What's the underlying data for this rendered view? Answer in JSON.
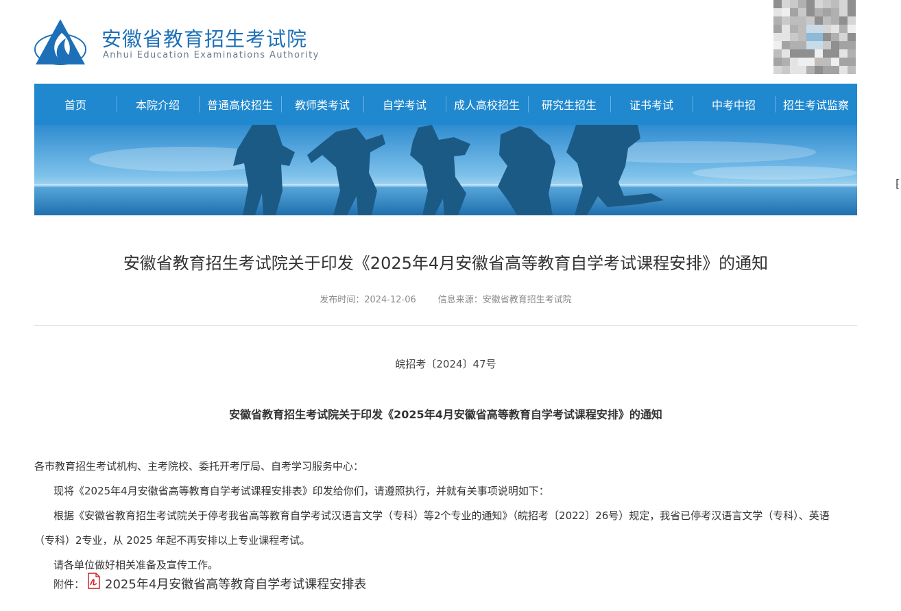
{
  "header": {
    "org_name": "安徽省教育招生考试院",
    "org_name_en": "Anhui Education Examinations Authority",
    "logo_icon": "triangle-flame-logo",
    "qr_icon": "qr-code-icon"
  },
  "nav": {
    "items": [
      {
        "label": "首页"
      },
      {
        "label": "本院介绍"
      },
      {
        "label": "普通高校招生"
      },
      {
        "label": "教师类考试"
      },
      {
        "label": "自学考试"
      },
      {
        "label": "成人高校招生"
      },
      {
        "label": "研究生招生"
      },
      {
        "label": "证书考试"
      },
      {
        "label": "中考中招"
      },
      {
        "label": "招生考试监察"
      }
    ]
  },
  "article": {
    "title": "安徽省教育招生考试院关于印发《2025年4月安徽省高等教育自学考试课程安排》的通知",
    "publish_time": "发布时间：2024-12-06",
    "source": "信息来源：安徽省教育招生考试院",
    "doc_number": "皖招考〔2024〕47号",
    "doc_title": "安徽省教育招生考试院关于印发《2025年4月安徽省高等教育自学考试课程安排》的通知",
    "paragraphs": [
      "各市教育招生考试机构、主考院校、委托开考厅局、自考学习服务中心：",
      "现将《2025年4月安徽省高等教育自学考试课程安排表》印发给你们，请遵照执行，并就有关事项说明如下：",
      "根据《安徽省教育招生考试院关于停考我省高等教育自学考试汉语言文学（专科）等2个专业的通知》（皖招考〔2022〕26号）规定，我省已停考汉语言文学（专科）、英语（专科）2专业，从 2025 年起不再安排以上专业课程考试。",
      "请各单位做好相关准备及宣传工作。"
    ],
    "attachment_label": "附件：",
    "attachment_name": "2025年4月安徽省高等教育自学考试课程安排表",
    "attachment_icon": "pdf-file-icon"
  },
  "colors": {
    "nav_bg": "#1f88cf",
    "brand_blue": "#1d70b8",
    "silhouette": "#1c5a86"
  }
}
